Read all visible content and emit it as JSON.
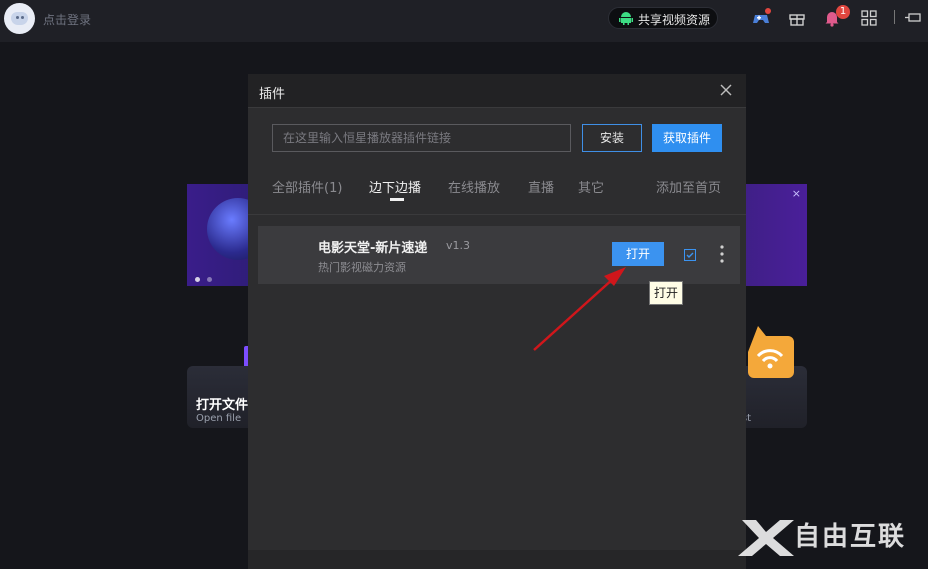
{
  "topbar": {
    "login_label": "点击登录",
    "share_label": "共享视频资源",
    "notification_count": "1"
  },
  "background": {
    "card_left_title": "打开文件",
    "card_left_sub": "Open file",
    "card_right_sub": "st"
  },
  "modal": {
    "title": "插件",
    "input_placeholder": "在这里输入恒星播放器插件链接",
    "install_label": "安装",
    "get_plugins_label": "获取插件",
    "tabs": [
      {
        "label": "全部插件(1)"
      },
      {
        "label": "边下边播"
      },
      {
        "label": "在线播放"
      },
      {
        "label": "直播"
      },
      {
        "label": "其它"
      }
    ],
    "active_tab": "边下边播",
    "add_home_label": "添加至首页",
    "plugin": {
      "name": "电影天堂-新片速递",
      "version": "v1.3",
      "description": "热门影视磁力资源",
      "open_label": "打开",
      "checked": true
    },
    "tooltip": "打开"
  },
  "colors": {
    "accent_blue": "#2f8ff0",
    "arrow_red": "#d0161b",
    "badge_red": "#e0463f"
  },
  "watermark": "自由互联"
}
